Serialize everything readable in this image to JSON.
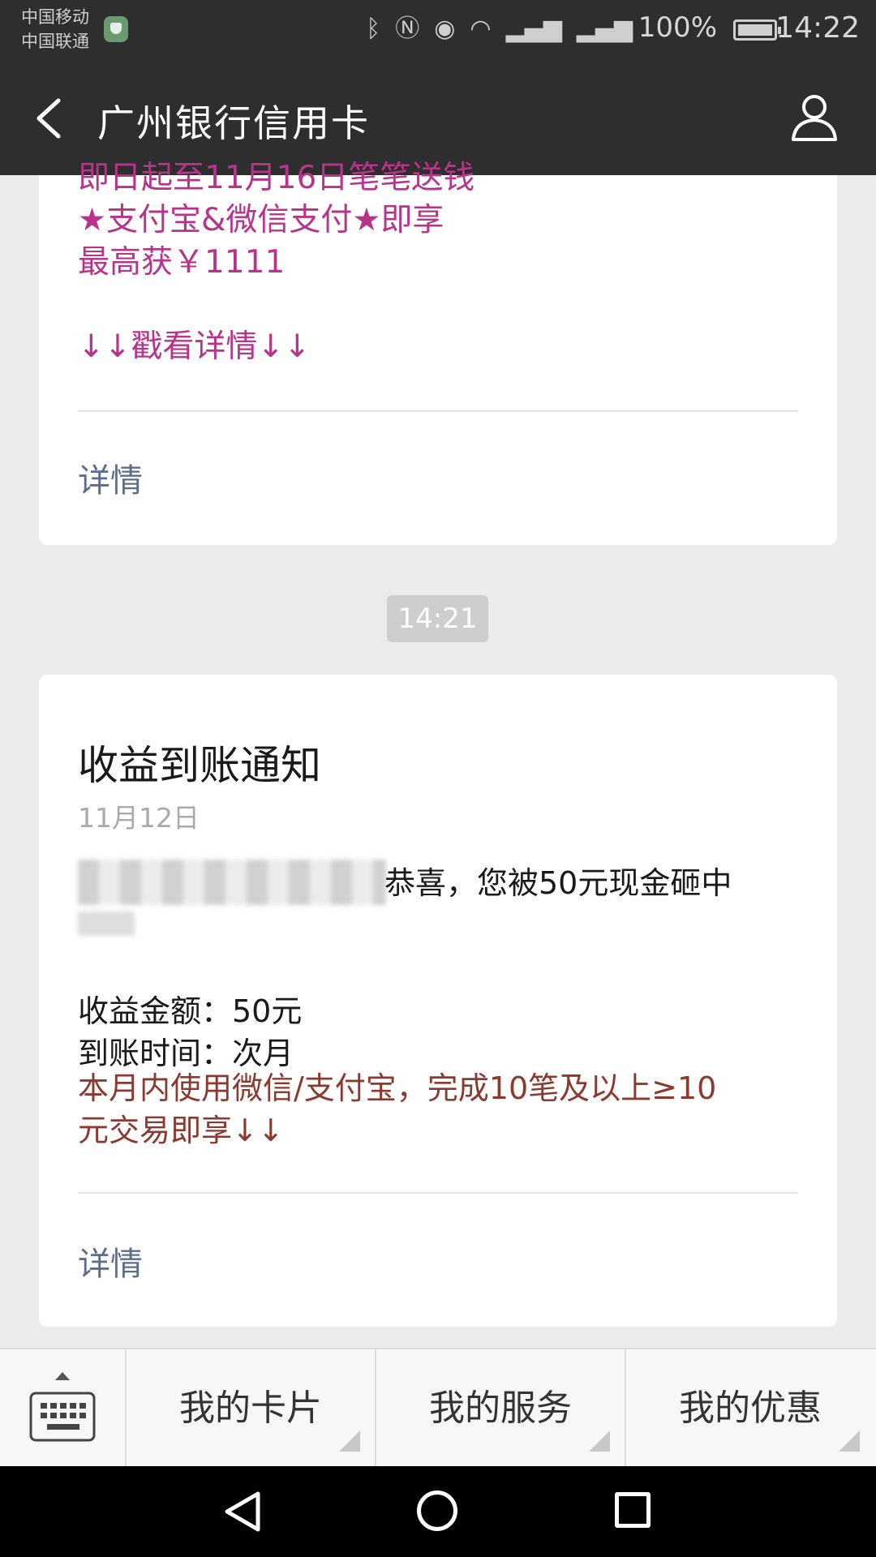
{
  "status_bar": {
    "carrier_1": "中国移动",
    "carrier_2": "中国联通",
    "battery": "100%",
    "time": "14:22",
    "icons": [
      "bluetooth-icon",
      "nfc-icon",
      "eye-icon",
      "wifi-icon",
      "signal-2g-icon",
      "signal-4g-icon",
      "battery-icon"
    ]
  },
  "header": {
    "title": "广州银行信用卡"
  },
  "card1": {
    "lines": [
      "即日起至11月16日笔笔送钱",
      "★支付宝&微信支付★即享",
      "最高获￥1111",
      "↓↓戳看详情↓↓"
    ],
    "detail": "详情"
  },
  "timestamp": "14:21",
  "card2": {
    "title": "收益到账通知",
    "date": "11月12日",
    "congrats": "恭喜，您被50元现金砸中",
    "amount": "收益金额：50元",
    "arrival": "到账时间：次月",
    "note_line1": "本月内使用微信/支付宝，完成10笔及以上≥10",
    "note_line2": "元交易即享↓↓",
    "detail": "详情"
  },
  "menu": {
    "items": [
      "我的卡片",
      "我的服务",
      "我的优惠"
    ]
  },
  "colors": {
    "bar": "#2e2e2e",
    "promo": "#b8338a",
    "note": "#8b3a30",
    "link": "#5b6f8c",
    "background": "#ebebeb"
  }
}
